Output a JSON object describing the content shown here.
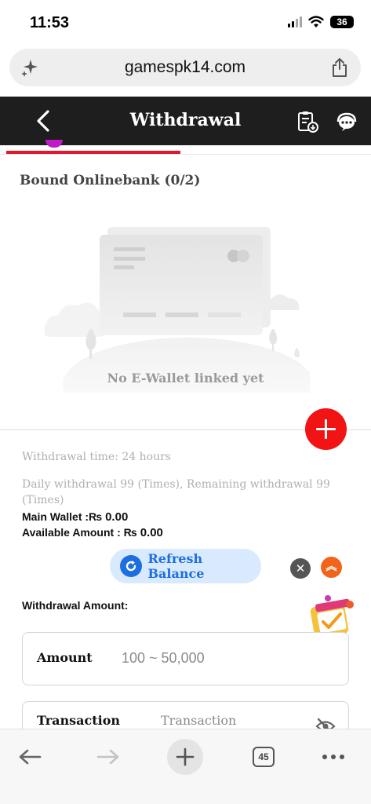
{
  "status_bar": {
    "time": "11:53",
    "battery": "36"
  },
  "browser": {
    "url": "gamespk14.com",
    "tab_count": "45"
  },
  "header": {
    "title": "Withdrawal"
  },
  "bound_section": {
    "title": "Bound Onlinebank (0/2)",
    "empty_text": "No E-Wallet linked yet"
  },
  "info": {
    "withdrawal_time": "Withdrawal time:  24 hours",
    "daily_withdrawal": "Daily withdrawal 99 (Times), Remaining withdrawal 99 (Times)",
    "main_wallet_label": "Main Wallet :₨ ",
    "main_wallet_value": "0.00",
    "available_label": "Available Amount : ₨ ",
    "available_value": "0.00"
  },
  "refresh_button": {
    "label": "Refresh Balance"
  },
  "withdrawal_amount": {
    "title": "Withdrawal Amount:"
  },
  "fields": {
    "amount": {
      "label": "Amount",
      "placeholder": "100 ~ 50,000"
    },
    "transaction": {
      "label": "Transaction",
      "placeholder": "Transaction"
    }
  },
  "colors": {
    "header_bg": "#1e1e1e",
    "accent_red": "#f21414",
    "refresh_blue": "#1d6fe0",
    "tab_indicator": "#e0192d"
  },
  "icons": [
    "sparkle-icon",
    "share-icon",
    "back-arrow-icon",
    "withdraw-record-icon",
    "customer-service-icon",
    "plus-icon",
    "refresh-icon",
    "close-icon",
    "double-chevron-up-icon",
    "gift-box-icon",
    "eye-hidden-icon",
    "browser-back-icon",
    "browser-forward-icon",
    "new-tab-icon",
    "tabs-icon",
    "more-icon"
  ]
}
